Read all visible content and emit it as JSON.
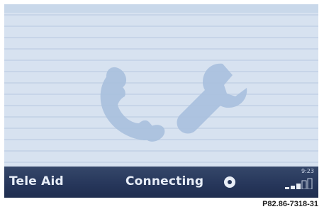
{
  "status_bar": {
    "service_label": "Tele Aid",
    "status_text": "Connecting",
    "time": "9:23",
    "signal_bars_filled": 3,
    "signal_bars_total": 5
  },
  "icons": {
    "background": [
      "phone-handset-icon",
      "wrench-icon"
    ],
    "status": [
      "record-icon",
      "signal-strength-icon"
    ]
  },
  "colors": {
    "display_background": "#d9e4f1",
    "stripe": "#c7d5e8",
    "status_bar": "#26365a",
    "text": "#e8eef8",
    "watermark_icon": "#a9c0de"
  },
  "caption": "P82.86-7318-31"
}
